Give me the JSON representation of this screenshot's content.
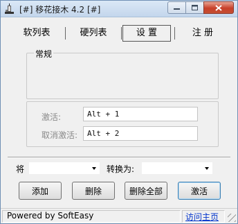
{
  "window": {
    "title": "[#] 移花接木 4.2 [#]"
  },
  "tabs": [
    {
      "label": "软列表",
      "active": false
    },
    {
      "label": "硬列表",
      "active": false
    },
    {
      "label": "设 置",
      "active": true
    },
    {
      "label": "注 册",
      "active": false
    }
  ],
  "general_group": {
    "title": "常规"
  },
  "hotkeys": {
    "activate_label": "激活:",
    "activate_value": "Alt + 1",
    "deactivate_label": "取消激活:",
    "deactivate_value": "Alt + 2"
  },
  "mapping": {
    "from_label": "将",
    "from_value": "",
    "to_label": "转换为:",
    "to_value": ""
  },
  "buttons": {
    "add": "添加",
    "delete": "删除",
    "delete_all": "删除全部",
    "activate": "激活"
  },
  "statusbar": {
    "text": "Powered by SoftEasy",
    "link": "访问主页"
  },
  "icons": {
    "app": "syringe-icon",
    "minimize": "minimize-icon",
    "maximize": "maximize-icon",
    "close": "close-icon",
    "dropdown": "chevron-down-icon"
  },
  "colors": {
    "link": "#0033cc",
    "close_button": "#c8402a",
    "focus_border": "#3c7fb1"
  }
}
